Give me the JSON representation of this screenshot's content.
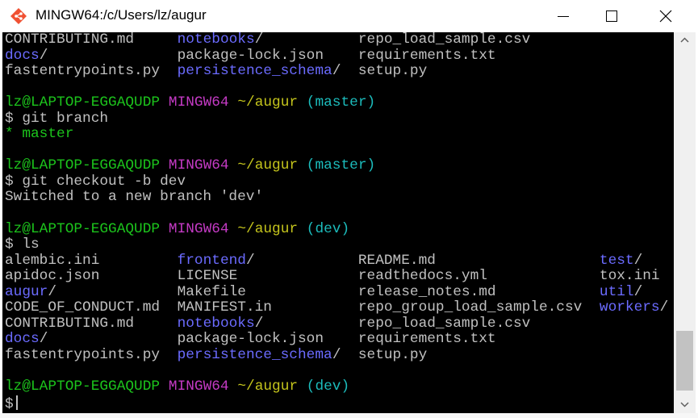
{
  "window": {
    "title": "MINGW64:/c/Users/lz/augur",
    "icon": "git-bash-icon",
    "controls": {
      "minimize": "minimize-icon",
      "maximize": "maximize-icon",
      "close": "close-icon"
    }
  },
  "colors": {
    "background": "#000000",
    "text": "#c0c0c0",
    "dir": "#6b6bff",
    "green": "#1cc41c",
    "magenta": "#c43ac4",
    "yellow": "#c4c41c",
    "cyan": "#1cbcbc"
  },
  "terminal": {
    "lines": [
      {
        "segments": [
          {
            "text": "CONTRIBUTING.md",
            "col": 0,
            "color": "#c0c0c0"
          },
          {
            "text": "notebooks",
            "col": 20,
            "color": "#6b6bff"
          },
          {
            "text": "/",
            "col": 29,
            "color": "#c0c0c0"
          },
          {
            "text": "repo_load_sample.csv",
            "col": 41,
            "color": "#c0c0c0"
          }
        ]
      },
      {
        "segments": [
          {
            "text": "docs",
            "col": 0,
            "color": "#6b6bff"
          },
          {
            "text": "/",
            "col": 4,
            "color": "#c0c0c0"
          },
          {
            "text": "package-lock.json",
            "col": 20,
            "color": "#c0c0c0"
          },
          {
            "text": "requirements.txt",
            "col": 41,
            "color": "#c0c0c0"
          }
        ]
      },
      {
        "segments": [
          {
            "text": "fastentrypoints.py",
            "col": 0,
            "color": "#c0c0c0"
          },
          {
            "text": "persistence_schema",
            "col": 20,
            "color": "#6b6bff"
          },
          {
            "text": "/",
            "col": 38,
            "color": "#c0c0c0"
          },
          {
            "text": "setup.py",
            "col": 41,
            "color": "#c0c0c0"
          }
        ]
      },
      {
        "segments": []
      },
      {
        "segments": [
          {
            "text": "lz@LAPTOP-EGGAQUDP",
            "col": 0,
            "color": "#1cc41c"
          },
          {
            "text": "MINGW64",
            "col": 19,
            "color": "#c43ac4"
          },
          {
            "text": "~/augur",
            "col": 27,
            "color": "#c4c41c"
          },
          {
            "text": "(master)",
            "col": 35,
            "color": "#1cbcbc"
          }
        ]
      },
      {
        "segments": [
          {
            "text": "$ git branch",
            "col": 0,
            "color": "#c0c0c0"
          }
        ]
      },
      {
        "segments": [
          {
            "text": "* master",
            "col": 0,
            "color": "#1cc41c"
          }
        ]
      },
      {
        "segments": []
      },
      {
        "segments": [
          {
            "text": "lz@LAPTOP-EGGAQUDP",
            "col": 0,
            "color": "#1cc41c"
          },
          {
            "text": "MINGW64",
            "col": 19,
            "color": "#c43ac4"
          },
          {
            "text": "~/augur",
            "col": 27,
            "color": "#c4c41c"
          },
          {
            "text": "(master)",
            "col": 35,
            "color": "#1cbcbc"
          }
        ]
      },
      {
        "segments": [
          {
            "text": "$ git checkout -b dev",
            "col": 0,
            "color": "#c0c0c0"
          }
        ]
      },
      {
        "segments": [
          {
            "text": "Switched to a new branch 'dev'",
            "col": 0,
            "color": "#c0c0c0"
          }
        ]
      },
      {
        "segments": []
      },
      {
        "segments": [
          {
            "text": "lz@LAPTOP-EGGAQUDP",
            "col": 0,
            "color": "#1cc41c"
          },
          {
            "text": "MINGW64",
            "col": 19,
            "color": "#c43ac4"
          },
          {
            "text": "~/augur",
            "col": 27,
            "color": "#c4c41c"
          },
          {
            "text": "(dev)",
            "col": 35,
            "color": "#1cbcbc"
          }
        ]
      },
      {
        "segments": [
          {
            "text": "$ ls",
            "col": 0,
            "color": "#c0c0c0"
          }
        ]
      },
      {
        "segments": [
          {
            "text": "alembic.ini",
            "col": 0,
            "color": "#c0c0c0"
          },
          {
            "text": "frontend",
            "col": 20,
            "color": "#6b6bff"
          },
          {
            "text": "/",
            "col": 28,
            "color": "#c0c0c0"
          },
          {
            "text": "README.md",
            "col": 41,
            "color": "#c0c0c0"
          },
          {
            "text": "test",
            "col": 69,
            "color": "#6b6bff"
          },
          {
            "text": "/",
            "col": 73,
            "color": "#c0c0c0"
          }
        ]
      },
      {
        "segments": [
          {
            "text": "apidoc.json",
            "col": 0,
            "color": "#c0c0c0"
          },
          {
            "text": "LICENSE",
            "col": 20,
            "color": "#c0c0c0"
          },
          {
            "text": "readthedocs.yml",
            "col": 41,
            "color": "#c0c0c0"
          },
          {
            "text": "tox.ini",
            "col": 69,
            "color": "#c0c0c0"
          }
        ]
      },
      {
        "segments": [
          {
            "text": "augur",
            "col": 0,
            "color": "#6b6bff"
          },
          {
            "text": "/",
            "col": 5,
            "color": "#c0c0c0"
          },
          {
            "text": "Makefile",
            "col": 20,
            "color": "#c0c0c0"
          },
          {
            "text": "release_notes.md",
            "col": 41,
            "color": "#c0c0c0"
          },
          {
            "text": "util",
            "col": 69,
            "color": "#6b6bff"
          },
          {
            "text": "/",
            "col": 73,
            "color": "#c0c0c0"
          }
        ]
      },
      {
        "segments": [
          {
            "text": "CODE_OF_CONDUCT.md",
            "col": 0,
            "color": "#c0c0c0"
          },
          {
            "text": "MANIFEST.in",
            "col": 20,
            "color": "#c0c0c0"
          },
          {
            "text": "repo_group_load_sample.csv",
            "col": 41,
            "color": "#c0c0c0"
          },
          {
            "text": "workers",
            "col": 69,
            "color": "#6b6bff"
          },
          {
            "text": "/",
            "col": 76,
            "color": "#c0c0c0"
          }
        ]
      },
      {
        "segments": [
          {
            "text": "CONTRIBUTING.md",
            "col": 0,
            "color": "#c0c0c0"
          },
          {
            "text": "notebooks",
            "col": 20,
            "color": "#6b6bff"
          },
          {
            "text": "/",
            "col": 29,
            "color": "#c0c0c0"
          },
          {
            "text": "repo_load_sample.csv",
            "col": 41,
            "color": "#c0c0c0"
          }
        ]
      },
      {
        "segments": [
          {
            "text": "docs",
            "col": 0,
            "color": "#6b6bff"
          },
          {
            "text": "/",
            "col": 4,
            "color": "#c0c0c0"
          },
          {
            "text": "package-lock.json",
            "col": 20,
            "color": "#c0c0c0"
          },
          {
            "text": "requirements.txt",
            "col": 41,
            "color": "#c0c0c0"
          }
        ]
      },
      {
        "segments": [
          {
            "text": "fastentrypoints.py",
            "col": 0,
            "color": "#c0c0c0"
          },
          {
            "text": "persistence_schema",
            "col": 20,
            "color": "#6b6bff"
          },
          {
            "text": "/",
            "col": 38,
            "color": "#c0c0c0"
          },
          {
            "text": "setup.py",
            "col": 41,
            "color": "#c0c0c0"
          }
        ]
      },
      {
        "segments": []
      },
      {
        "segments": [
          {
            "text": "lz@LAPTOP-EGGAQUDP",
            "col": 0,
            "color": "#1cc41c"
          },
          {
            "text": "MINGW64",
            "col": 19,
            "color": "#c43ac4"
          },
          {
            "text": "~/augur",
            "col": 27,
            "color": "#c4c41c"
          },
          {
            "text": "(dev)",
            "col": 35,
            "color": "#1cbcbc"
          }
        ]
      },
      {
        "segments": [
          {
            "text": "$",
            "col": 0,
            "color": "#c0c0c0"
          }
        ],
        "cursor": true
      }
    ]
  }
}
